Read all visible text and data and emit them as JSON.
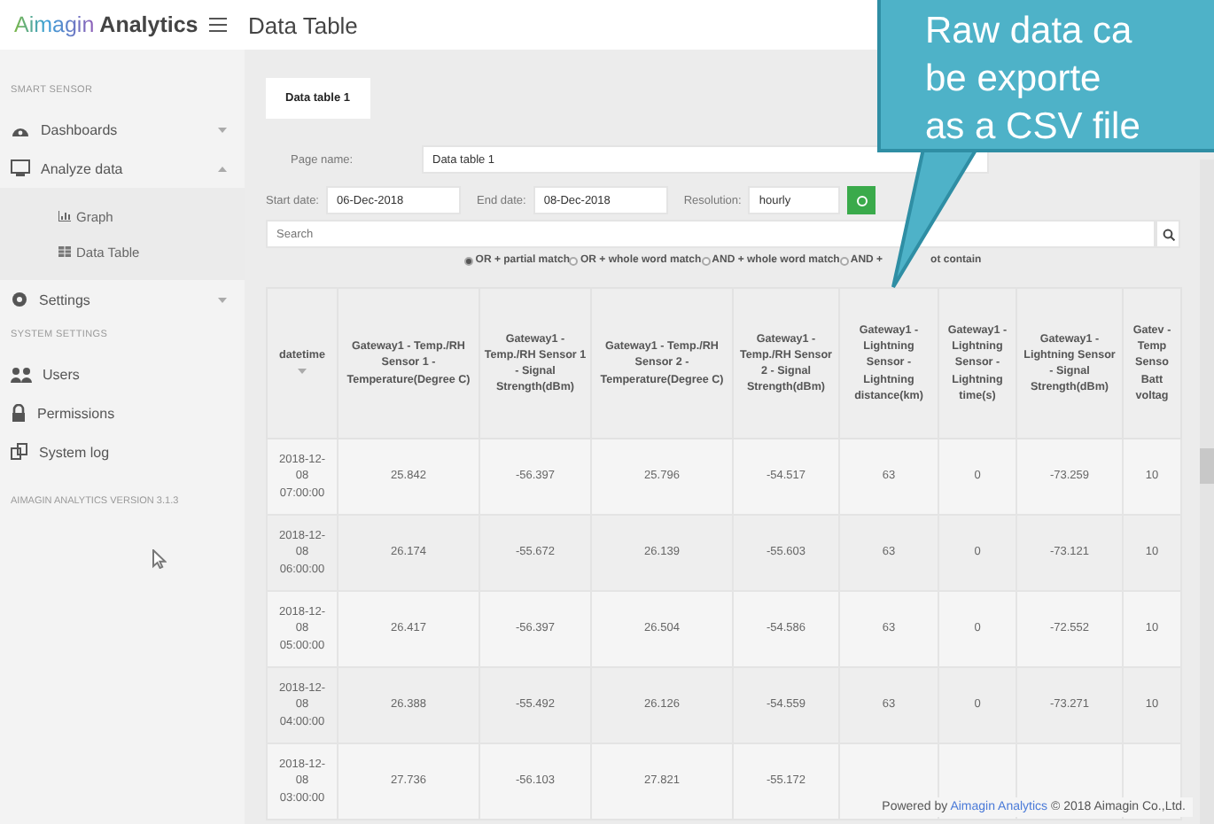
{
  "header": {
    "logo_brand": "Aimagin",
    "logo_product": "Analytics",
    "title": "Data Table"
  },
  "sidebar": {
    "sections": [
      {
        "title": "SMART SENSOR",
        "items": [
          {
            "label": "Dashboards",
            "expanded": false
          },
          {
            "label": "Analyze data",
            "expanded": true,
            "children": [
              {
                "label": "Graph"
              },
              {
                "label": "Data Table"
              }
            ]
          },
          {
            "label": "Settings",
            "expanded": false
          }
        ]
      },
      {
        "title": "SYSTEM SETTINGS",
        "items": [
          {
            "label": "Users"
          },
          {
            "label": "Permissions"
          },
          {
            "label": "System log"
          }
        ]
      }
    ],
    "version": "AIMAGIN ANALYTICS VERSION 3.1.3"
  },
  "tabs": [
    {
      "label": "Data table 1",
      "selected": true
    }
  ],
  "form": {
    "page_name_label": "Page name:",
    "page_name": "Data table 1",
    "start_label": "Start date:",
    "start_date": "06-Dec-2018",
    "end_label": "End date:",
    "end_date": "08-Dec-2018",
    "resolution_label": "Resolution:",
    "resolution": "hourly",
    "search_placeholder": "Search"
  },
  "match_options": [
    {
      "label": "OR + partial match",
      "selected": true
    },
    {
      "label": "OR + whole word match",
      "selected": false
    },
    {
      "label": "AND + whole word match",
      "selected": false
    },
    {
      "label": "AND +",
      "label_tail": "ot contain",
      "selected": false
    }
  ],
  "table": {
    "columns": [
      "datetime",
      "Gateway1 - Temp./RH Sensor 1 - Temperature(Degree C)",
      "Gateway1 - Temp./RH Sensor 1 - Signal Strength(dBm)",
      "Gateway1 - Temp./RH Sensor 2 - Temperature(Degree C)",
      "Gateway1 - Temp./RH Sensor 2 - Signal Strength(dBm)",
      "Gateway1 - Lightning Sensor - Lightning distance(km)",
      "Gateway1 - Lightning Sensor - Lightning time(s)",
      "Gateway1 - Lightning Sensor - Signal Strength(dBm)",
      "Gatev - Temp Senso Batt voltag"
    ],
    "rows": [
      [
        "2018-12-08 07:00:00",
        "25.842",
        "-56.397",
        "25.796",
        "-54.517",
        "63",
        "0",
        "-73.259",
        "10"
      ],
      [
        "2018-12-08 06:00:00",
        "26.174",
        "-55.672",
        "26.139",
        "-55.603",
        "63",
        "0",
        "-73.121",
        "10"
      ],
      [
        "2018-12-08 05:00:00",
        "26.417",
        "-56.397",
        "26.504",
        "-54.586",
        "63",
        "0",
        "-72.552",
        "10"
      ],
      [
        "2018-12-08 04:00:00",
        "26.388",
        "-55.492",
        "26.126",
        "-54.559",
        "63",
        "0",
        "-73.271",
        "10"
      ],
      [
        "2018-12-08 03:00:00",
        "27.736",
        "-56.103",
        "27.821",
        "-55.172"
      ]
    ]
  },
  "footer": {
    "prefix": "Powered by",
    "link": "Aimagin Analytics",
    "suffix": "© 2018 Aimagin Co.,Ltd."
  },
  "callout": {
    "lines": [
      "Raw data ca",
      "be exporte",
      "as a CSV file"
    ]
  }
}
